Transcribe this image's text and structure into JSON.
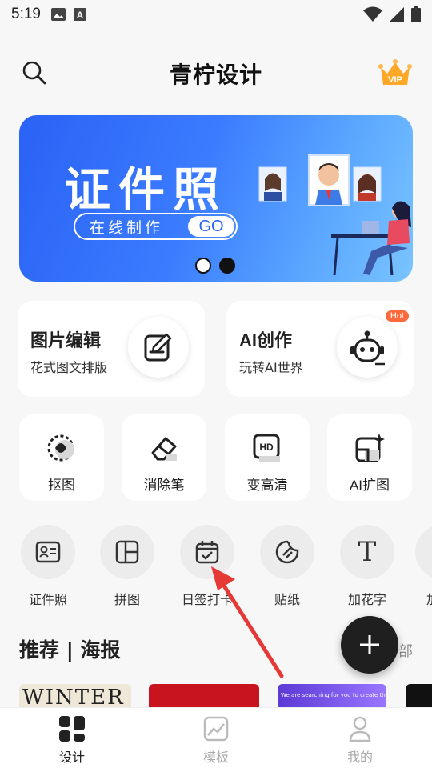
{
  "status_bar": {
    "time": "5:19"
  },
  "header": {
    "title": "青柠设计",
    "vip_label": "VIP"
  },
  "banner": {
    "title": "证件照",
    "subtitle": "在线制作",
    "cta": "GO"
  },
  "feature_cards": [
    {
      "title": "图片编辑",
      "subtitle": "花式图文排版"
    },
    {
      "title": "AI创作",
      "subtitle": "玩转AI世界",
      "badge": "Hot"
    }
  ],
  "tools": [
    {
      "label": "抠图"
    },
    {
      "label": "消除笔"
    },
    {
      "label": "变高清",
      "icon_text": "HD"
    },
    {
      "label": "AI扩图"
    }
  ],
  "quick_actions": [
    {
      "label": "证件照"
    },
    {
      "label": "拼图"
    },
    {
      "label": "日签打卡"
    },
    {
      "label": "贴纸"
    },
    {
      "label": "加花字",
      "icon_text": "T"
    },
    {
      "label": "加"
    }
  ],
  "section": {
    "title": "推荐 | 海报",
    "more": "部"
  },
  "thumbnails": [
    {
      "text": "WINTER"
    },
    {
      "text": ""
    },
    {
      "text": "We are searching for you to create the future"
    },
    {
      "text": ""
    }
  ],
  "tabbar": {
    "items": [
      {
        "label": "设计",
        "active": true
      },
      {
        "label": "模板",
        "active": false
      },
      {
        "label": "我的",
        "active": false
      }
    ]
  },
  "colors": {
    "brand_blue": "#2a62f5",
    "fab": "#1f1f1f",
    "vip": "#ffa726",
    "hot": "#ff6a3d",
    "arrow": "#e53935"
  }
}
